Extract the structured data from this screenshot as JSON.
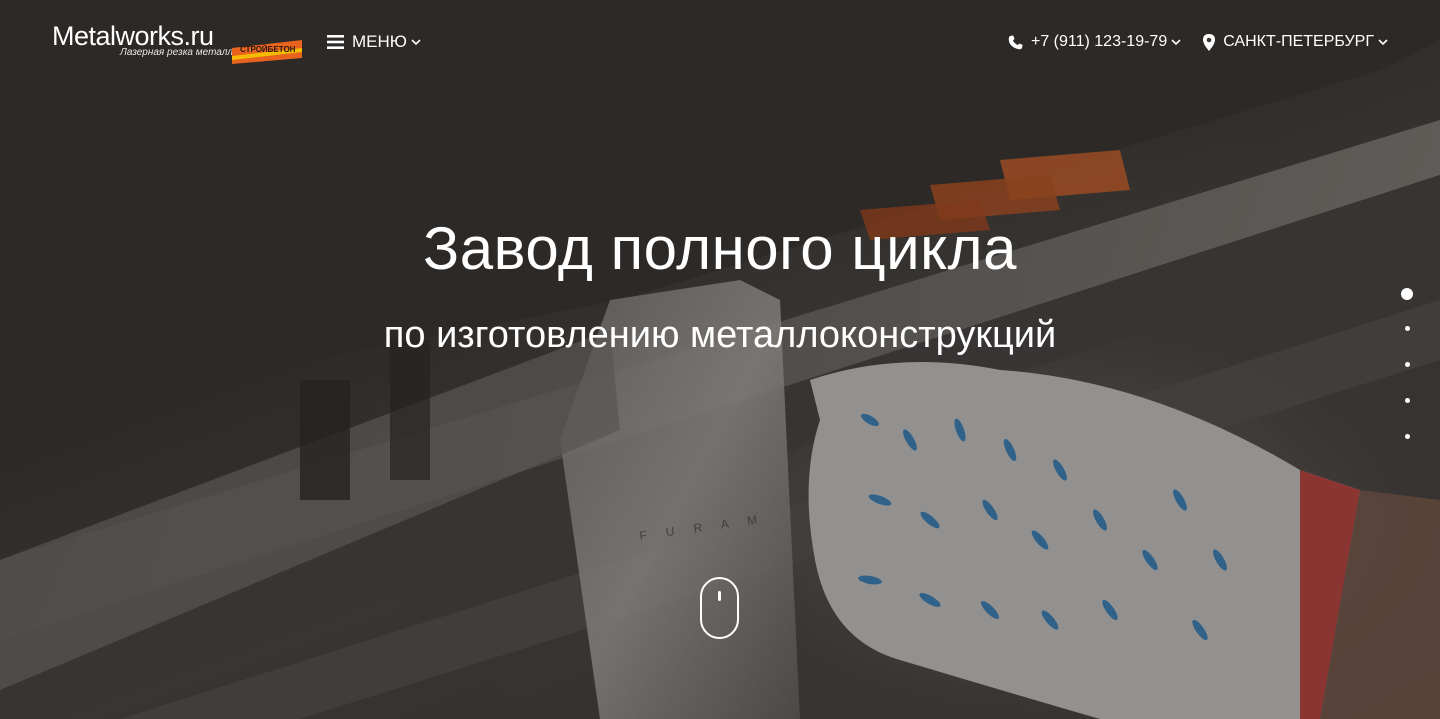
{
  "header": {
    "logo": {
      "name": "Metalworks.ru",
      "tagline": "Лазерная резка металла",
      "badge": "СТРОЙБЕТОН"
    },
    "menu_label": "МЕНЮ",
    "phone": "+7 (911) 123-19-79",
    "city": "САНКТ-ПЕТЕРБУРГ"
  },
  "hero": {
    "title": "Завод полного цикла",
    "subtitle": "по изготовлению металлоконструкций",
    "slides": {
      "count": 5,
      "active_index": 0
    }
  },
  "icons": {
    "menu": "bars-icon",
    "phone": "phone-icon",
    "location": "map-marker-icon",
    "dropdown": "chevron-down-icon",
    "scroll": "mouse-scroll-icon"
  },
  "colors": {
    "text": "#ffffff",
    "badge_accent": "#e8641e"
  }
}
